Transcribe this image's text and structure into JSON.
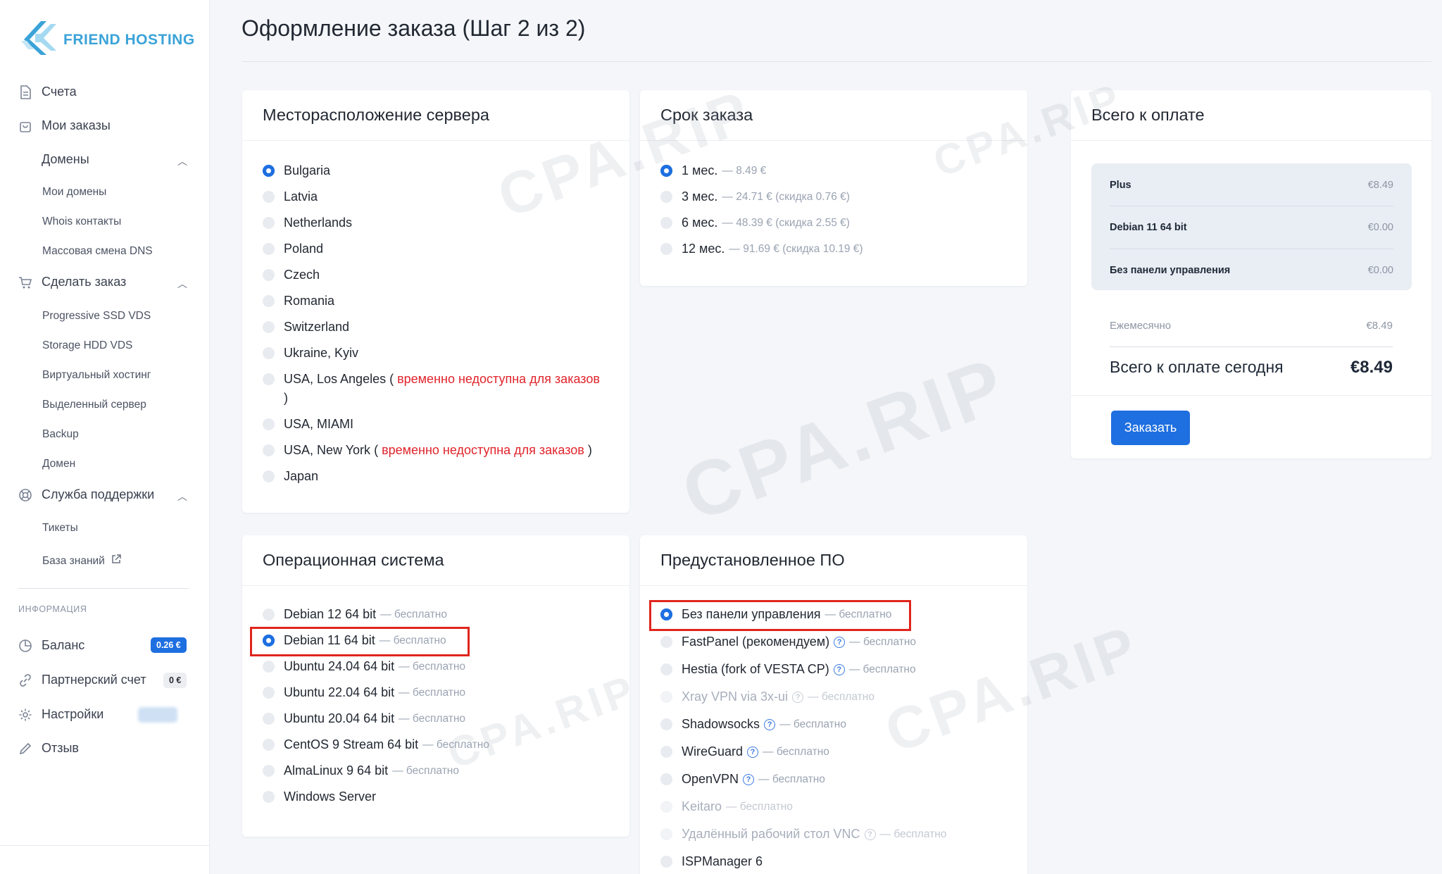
{
  "brand": {
    "name": "FRIEND HOSTING"
  },
  "sidebar": {
    "accounts": "Счета",
    "my_orders": "Мои заказы",
    "domains": "Домены",
    "domains_sub": [
      "Мои домены",
      "Whois контакты",
      "Массовая смена DNS"
    ],
    "make_order": "Сделать заказ",
    "make_order_sub": [
      "Progressive SSD VDS",
      "Storage HDD VDS",
      "Виртуальный хостинг",
      "Выделенный сервер",
      "Backup",
      "Домен"
    ],
    "support": "Служба поддержки",
    "support_sub": [
      "Тикеты",
      "База знаний"
    ],
    "info_label": "ИНФОРМАЦИЯ",
    "balance": "Баланс",
    "balance_value": "0.26 €",
    "partner": "Партнерский счет",
    "partner_value": "0 €",
    "settings": "Настройки",
    "feedback": "Отзыв"
  },
  "page": {
    "title": "Оформление заказа (Шаг 2 из 2)"
  },
  "location": {
    "title": "Месторасположение сервера",
    "unavailable": "временно недоступна для заказов",
    "options": [
      "Bulgaria",
      "Latvia",
      "Netherlands",
      "Poland",
      "Czech",
      "Romania",
      "Switzerland",
      "Ukraine, Kyiv",
      "USA, Los Angeles",
      "USA, MIAMI",
      "USA, New York",
      "Japan"
    ]
  },
  "term": {
    "title": "Срок заказа",
    "options": [
      {
        "label": "1 мес.",
        "note": "— 8.49 €"
      },
      {
        "label": "3 мес.",
        "note": "— 24.71 € (скидка 0.76 €)"
      },
      {
        "label": "6 мес.",
        "note": "— 48.39 € (скидка 2.55 €)"
      },
      {
        "label": "12 мес.",
        "note": "— 91.69 € (скидка 10.19 €)"
      }
    ]
  },
  "summary": {
    "title": "Всего к оплате",
    "items": [
      {
        "name": "Plus",
        "price": "€8.49"
      },
      {
        "name": "Debian 11 64 bit",
        "price": "€0.00"
      },
      {
        "name": "Без панели управления",
        "price": "€0.00"
      }
    ],
    "monthly_label": "Ежемесячно",
    "monthly_value": "€8.49",
    "total_label": "Всего к оплате сегодня",
    "total_value": "€8.49",
    "order_button": "Заказать"
  },
  "os": {
    "title": "Операционная система",
    "free": "— бесплатно",
    "options": [
      "Debian 12 64 bit",
      "Debian 11 64 bit",
      "Ubuntu 24.04 64 bit",
      "Ubuntu 22.04 64 bit",
      "Ubuntu 20.04 64 bit",
      "CentOS 9 Stream 64 bit",
      "AlmaLinux 9 64 bit",
      "Windows Server"
    ]
  },
  "software": {
    "title": "Предустановленное ПО",
    "free": "— бесплатно",
    "options": [
      "Без панели управления",
      "FastPanel (рекомендуем)",
      "Hestia (fork of VESTA CP)",
      "Xray VPN via 3x-ui",
      "Shadowsocks",
      "WireGuard",
      "OpenVPN",
      "Keitaro",
      "Удалённый рабочий стол VNC",
      "ISPManager 6"
    ]
  },
  "watermark": "CPA.RIP"
}
